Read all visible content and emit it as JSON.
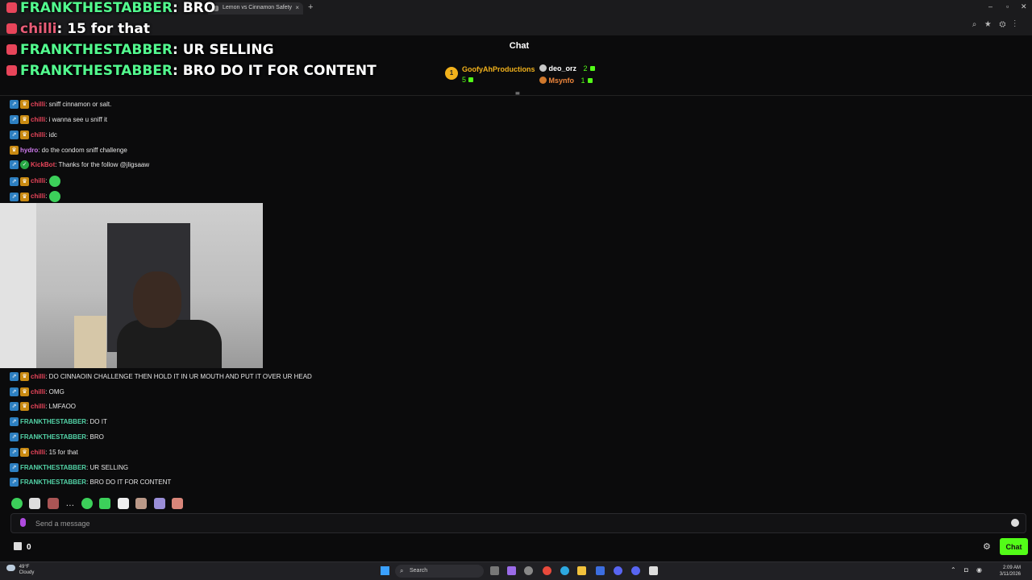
{
  "browser": {
    "tab_title": "Lemon vs Cinnamon Safety",
    "tab_close": "×",
    "new_tab": "+",
    "win_min": "–",
    "win_max": "▫",
    "win_close": "✕"
  },
  "alerts": [
    {
      "user": "FRANKTHESTABBER",
      "message": "BRO",
      "color": "#53fc8f"
    },
    {
      "user": "chilli",
      "message": "15 for that",
      "color": "#e85c77"
    },
    {
      "user": "FRANKTHESTABBER",
      "message": "UR SELLING",
      "color": "#53fc8f"
    },
    {
      "user": "FRANKTHESTABBER",
      "message": "BRO DO IT FOR CONTENT",
      "color": "#53fc8f"
    }
  ],
  "chat": {
    "title": "Chat",
    "leaderboard": [
      {
        "rank": "1",
        "name": "GoofyAhProductions",
        "count": "5"
      },
      {
        "rank": "2",
        "name": "deo_orz",
        "count": "2"
      },
      {
        "rank": "3",
        "name": "Msynfo",
        "count": "1"
      }
    ],
    "sort_icon": "≡",
    "messages_top": [
      {
        "user": "chilli",
        "text": ": sniff cinnamon or salt.",
        "color": "#e8455a",
        "badges": [
          "blue",
          "gold"
        ]
      },
      {
        "user": "chilli",
        "text": ": i wanna see u sniff it",
        "color": "#e8455a",
        "badges": [
          "blue",
          "gold"
        ]
      },
      {
        "user": "chilli",
        "text": ": idc",
        "color": "#e8455a",
        "badges": [
          "blue",
          "gold"
        ]
      },
      {
        "user": "hydro",
        "text": ": do the condom sniff challenge",
        "color": "#d07cf0",
        "badges": [
          "gold"
        ]
      },
      {
        "user": "KickBot",
        "text": ": Thanks for the follow @jligsaaw",
        "color": "#e8455a",
        "badges": [
          "blue",
          "green"
        ]
      },
      {
        "user": "chilli",
        "text": ": ",
        "color": "#e8455a",
        "badges": [
          "blue",
          "gold"
        ],
        "emote": true
      },
      {
        "user": "chilli",
        "text": ": ",
        "color": "#e8455a",
        "badges": [
          "blue",
          "gold"
        ],
        "emote": true
      }
    ],
    "messages_bottom": [
      {
        "user": "chilli",
        "text": ": DO CINNAOIN CHALLENGE THEN HOLD IT IN UR MOUTH AND PUT IT OVER UR HEAD",
        "color": "#e8455a",
        "badges": [
          "blue",
          "gold"
        ]
      },
      {
        "user": "chilli",
        "text": ": OMG",
        "color": "#e8455a",
        "badges": [
          "blue",
          "gold"
        ]
      },
      {
        "user": "chilli",
        "text": ": LMFAOO",
        "color": "#e8455a",
        "badges": [
          "blue",
          "gold"
        ]
      },
      {
        "user": "FRANKTHESTABBER",
        "text": ": DO IT",
        "color": "#53d4a8",
        "badges": [
          "blue"
        ]
      },
      {
        "user": "FRANKTHESTABBER",
        "text": ": BRO",
        "color": "#53d4a8",
        "badges": [
          "blue"
        ]
      },
      {
        "user": "chilli",
        "text": ": 15 for that",
        "color": "#e8455a",
        "badges": [
          "blue",
          "gold"
        ]
      },
      {
        "user": "FRANKTHESTABBER",
        "text": ": UR SELLING",
        "color": "#53d4a8",
        "badges": [
          "blue"
        ]
      },
      {
        "user": "FRANKTHESTABBER",
        "text": ": BRO DO IT FOR CONTENT",
        "color": "#53d4a8",
        "badges": [
          "blue"
        ]
      }
    ],
    "emote_more": "…",
    "input_placeholder": "Send a message",
    "gift_count": "0",
    "send_label": "Chat",
    "accent": "#53fc18"
  },
  "taskbar": {
    "weather_temp": "49°F",
    "weather_desc": "Cloudy",
    "search_placeholder": "Search",
    "time": "2:09 AM",
    "date": "3/11/2026"
  }
}
